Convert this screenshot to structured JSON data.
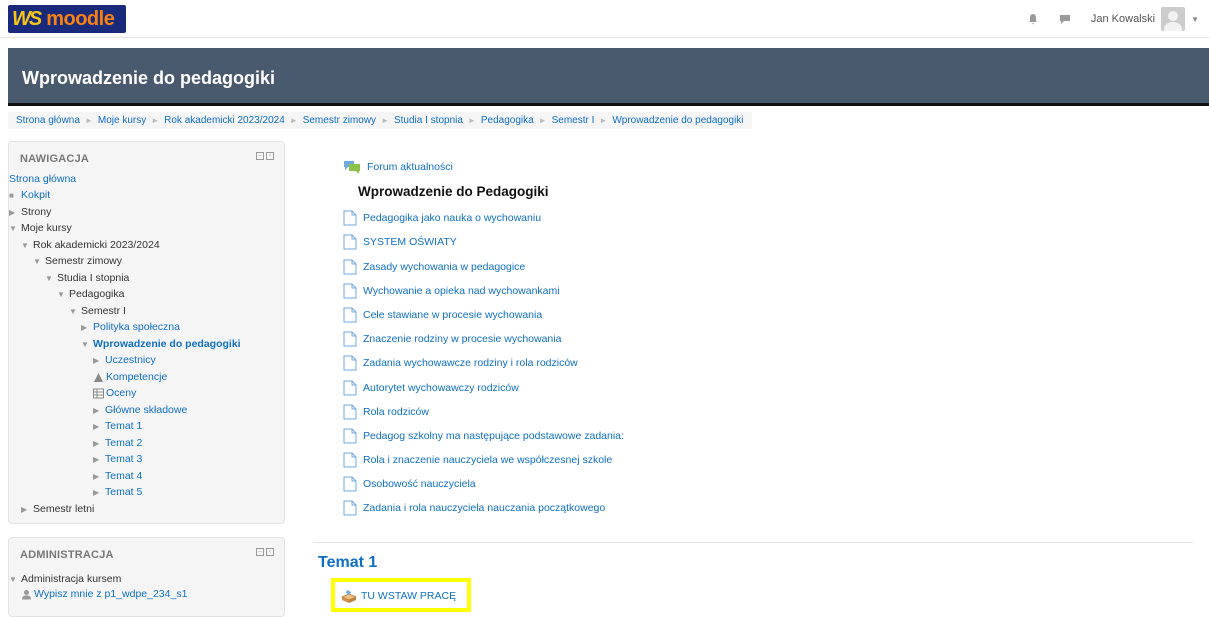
{
  "header": {
    "logo_text": "moodle",
    "user_name": "Jan Kowalski"
  },
  "page_title": "Wprowadzenie do pedagogiki",
  "breadcrumb": [
    "Strona główna",
    "Moje kursy",
    "Rok akademicki 2023/2024",
    "Semestr zimowy",
    "Studia I stopnia",
    "Pedagogika",
    "Semestr I",
    "Wprowadzenie do pedagogiki"
  ],
  "navigation": {
    "title": "NAWIGACJA",
    "items": [
      "Strona główna",
      "Kokpit",
      "Strony",
      "Moje kursy",
      "Rok akademicki 2023/2024",
      "Semestr zimowy",
      "Studia I stopnia",
      "Pedagogika",
      "Semestr I",
      "Polityka społeczna",
      "Wprowadzenie do pedagogiki",
      "Uczestnicy",
      "Kompetencje",
      "Oceny",
      "Główne składowe",
      "Temat 1",
      "Temat 2",
      "Temat 3",
      "Temat 4",
      "Temat 5",
      "Semestr letni"
    ]
  },
  "administration": {
    "title": "ADMINISTRACJA",
    "items": [
      "Administracja kursem",
      "Wypisz mnie z p1_wdpe_234_s1"
    ]
  },
  "main": {
    "forum_label": "Forum aktualności",
    "section_title": "Wprowadzenie do Pedagogiki",
    "resources": [
      "Pedagogika jako nauka o wychowaniu",
      "SYSTEM OŚWIATY",
      "Zasady wychowania w pedagogice",
      "Wychowanie a opieka nad wychowankami",
      "Cele stawiane w procesie wychowania",
      "Znaczenie rodziny w procesie wychowania",
      "Zadania wychowawcze rodziny i rola rodziców",
      "Autorytet wychowawczy rodziców",
      "Rola rodziców",
      "Pedagog szkolny ma następujące podstawowe zadania:",
      "Rola i znaczenie nauczyciela we współczesnej szkole",
      "Osobowość nauczyciela",
      "Zadania i rola nauczyciela nauczania początkowego"
    ],
    "topic1_title": "Temat 1",
    "assignment_label": "TU WSTAW PRACĘ"
  },
  "colors": {
    "header_band": "#4a5a6e",
    "link": "#0f6fc5",
    "highlight": "#ffff00"
  }
}
